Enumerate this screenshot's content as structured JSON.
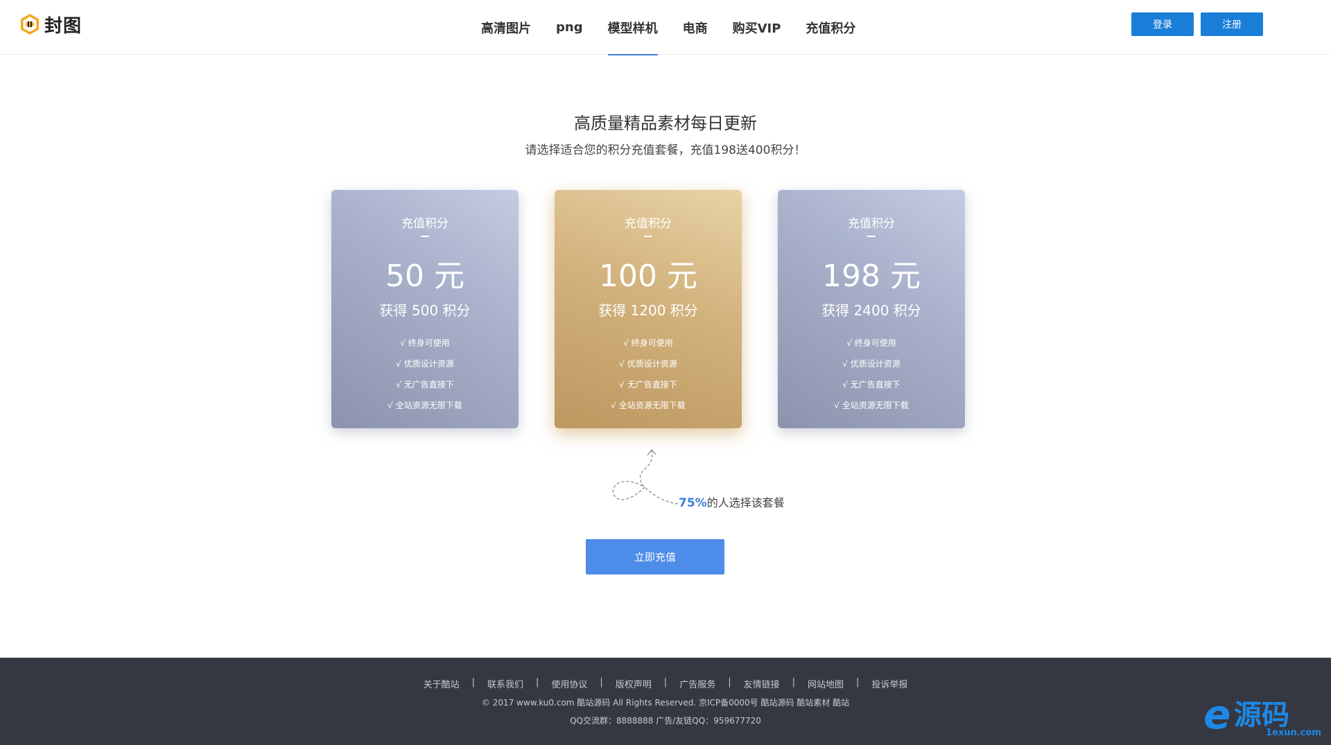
{
  "header": {
    "logo_text": "封图",
    "nav": [
      {
        "label": "高清图片"
      },
      {
        "label": "png"
      },
      {
        "label": "模型样机"
      },
      {
        "label": "电商"
      },
      {
        "label": "购买VIP"
      },
      {
        "label": "充值积分"
      }
    ],
    "active_nav": "模型样机",
    "login_label": "登录",
    "register_label": "注册"
  },
  "hero": {
    "headline": "高质量精品素材每日更新",
    "subline": "请选择适合您的积分充值套餐，充值198送400积分！"
  },
  "plans": [
    {
      "title": "充值积分",
      "price": "50 元",
      "points": "获得 500 积分",
      "style": "silver",
      "features": [
        "√ 终身可使用",
        "√ 优质设计资源",
        "√ 无广告直接下",
        "√ 全站资源无限下载"
      ]
    },
    {
      "title": "充值积分",
      "price": "100 元",
      "points": "获得 1200 积分",
      "style": "gold",
      "features": [
        "√ 终身可使用",
        "√ 优质设计资源",
        "√ 无广告直接下",
        "√ 全站资源无限下载"
      ]
    },
    {
      "title": "充值积分",
      "price": "198 元",
      "points": "获得 2400 积分",
      "style": "silver",
      "features": [
        "√ 终身可使用",
        "√ 优质设计资源",
        "√ 无广告直接下",
        "√ 全站资源无限下载"
      ]
    }
  ],
  "stat": {
    "percent": "75%",
    "text": "的人选择该套餐"
  },
  "recharge_label": "立即充值",
  "footer": {
    "links": [
      {
        "label": "关于酷站"
      },
      {
        "label": "联系我们"
      },
      {
        "label": "使用协议"
      },
      {
        "label": "版权声明"
      },
      {
        "label": "广告服务"
      },
      {
        "label": "友情链接"
      },
      {
        "label": "网站地图"
      },
      {
        "label": "投诉举报"
      }
    ],
    "copyright": "© 2017 www.ku0.com 酷站源码 All Rights Reserved. 京ICP备0000号 酷站源码 酷站素材 酷站",
    "qq": "QQ交流群：8888888 广告/友链QQ：959677720"
  },
  "watermark": {
    "main": "源码",
    "sub": "1exun.com"
  },
  "colors": {
    "primary": "#1a7ed8",
    "accent": "#3d7fd9",
    "recharge": "#4d8ce8",
    "footer_bg": "#353843",
    "gold": "#d2b27d",
    "silver": "#a6aec8"
  }
}
